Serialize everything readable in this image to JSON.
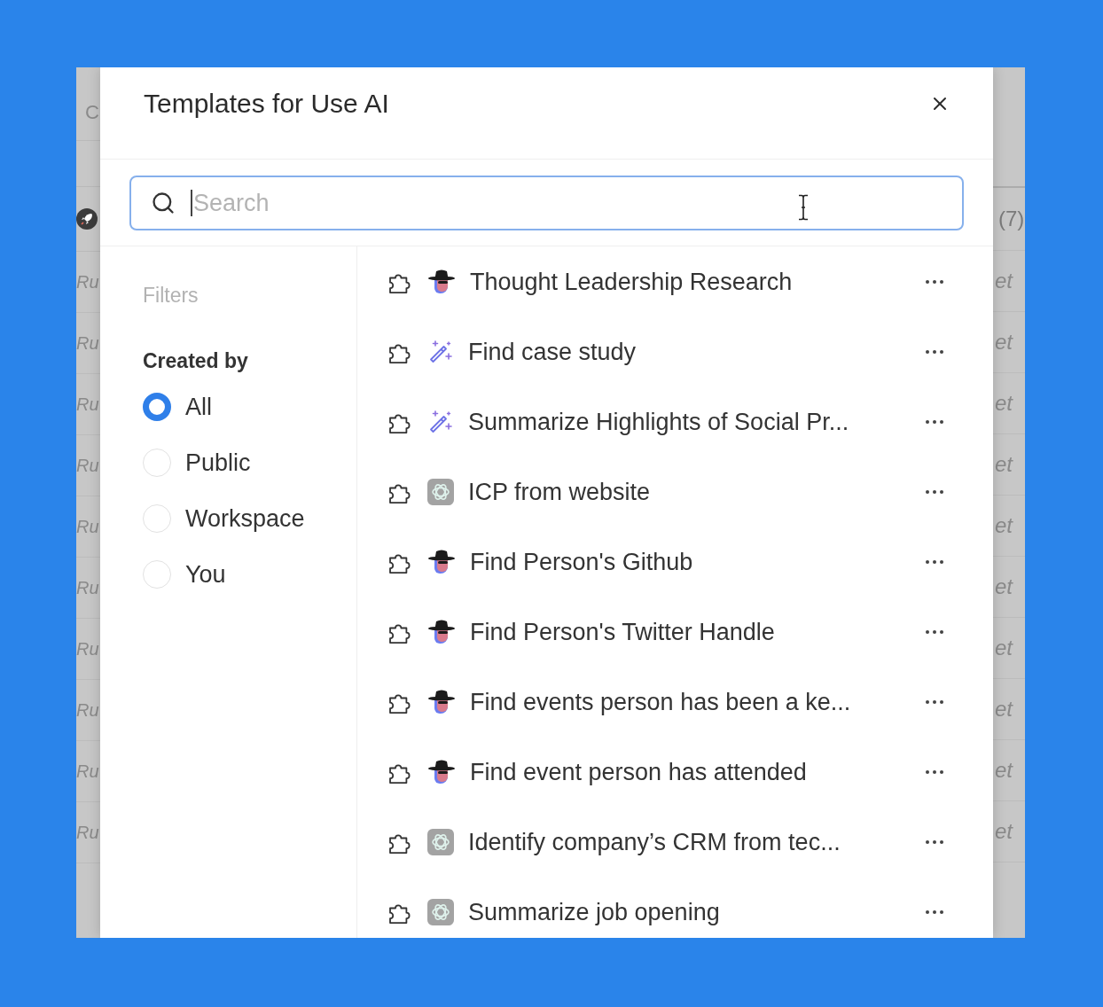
{
  "background_app": {
    "left_column": {
      "header_text": "C",
      "rows": [
        "Ru",
        "Ru",
        "Ru",
        "Ru",
        "Ru",
        "Ru",
        "Ru",
        "Ru",
        "Ru",
        "Ru"
      ]
    },
    "right_column": {
      "count_text": "(7)",
      "rows": [
        "et",
        "et",
        "et",
        "et",
        "et",
        "et",
        "et",
        "et",
        "et",
        "et"
      ]
    }
  },
  "dialog": {
    "title": "Templates for Use AI",
    "search": {
      "placeholder": "Search"
    },
    "filters": {
      "heading": "Filters",
      "group_label": "Created by",
      "options": [
        {
          "label": "All",
          "selected": true
        },
        {
          "label": "Public",
          "selected": false
        },
        {
          "label": "Workspace",
          "selected": false
        },
        {
          "label": "You",
          "selected": false
        }
      ]
    },
    "templates": [
      {
        "title": "Thought Leadership Research",
        "kind": "detective"
      },
      {
        "title": "Find case study",
        "kind": "wand"
      },
      {
        "title": "Summarize Highlights of Social Pr...",
        "kind": "wand"
      },
      {
        "title": "ICP from website",
        "kind": "knot"
      },
      {
        "title": "Find Person's Github",
        "kind": "detective"
      },
      {
        "title": "Find Person's Twitter Handle",
        "kind": "detective"
      },
      {
        "title": "Find events person has been a ke...",
        "kind": "detective"
      },
      {
        "title": "Find event person has attended",
        "kind": "detective"
      },
      {
        "title": "Identify company’s CRM from tec...",
        "kind": "knot"
      },
      {
        "title": "Summarize job opening",
        "kind": "knot"
      }
    ]
  }
}
